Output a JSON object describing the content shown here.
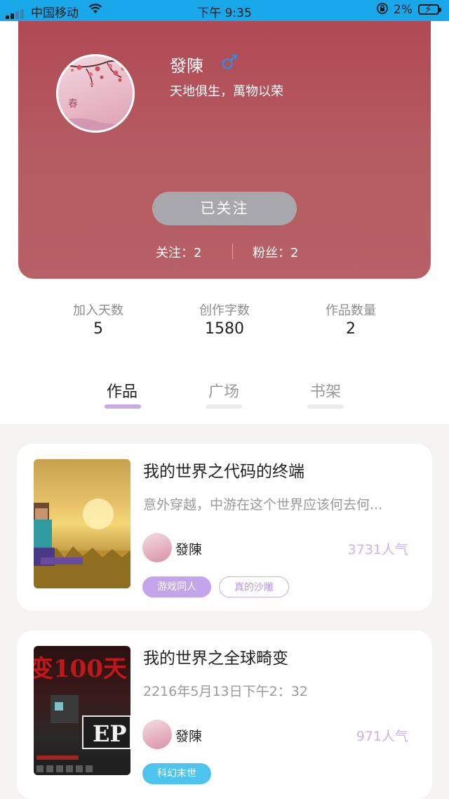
{
  "status_bar": {
    "carrier": "中国移动",
    "time": "下午 9:35",
    "battery_percent": "2%"
  },
  "profile": {
    "nickname": "發陳",
    "gender_symbol": "♂",
    "bio": "天地俱生，萬物以荣",
    "follow_button": "已关注",
    "following_text": "关注：2",
    "fans_text": "粉丝：2"
  },
  "stats": [
    {
      "label": "加入天数",
      "value": "5"
    },
    {
      "label": "创作字数",
      "value": "1580"
    },
    {
      "label": "作品数量",
      "value": "2"
    }
  ],
  "tabs": [
    {
      "label": "作品",
      "active": true
    },
    {
      "label": "广场",
      "active": false
    },
    {
      "label": "书架",
      "active": false
    }
  ],
  "works": [
    {
      "title": "我的世界之代码的终端",
      "subtitle": "意外穿越，中游在这个世界应该何去何...",
      "author": "發陳",
      "popularity": "3731人气",
      "tags": [
        "游戏同人",
        "真的沙雕"
      ]
    },
    {
      "title": "我的世界之全球畸变",
      "subtitle": "2216年5月13日下午2：32",
      "author": "發陳",
      "popularity": "971人气",
      "tags": [
        "科幻末世"
      ]
    }
  ],
  "colors": {
    "header": "#b24d56",
    "accent_purple": "#c4a4ea",
    "tag_blue": "#4cc4ee",
    "status_bar": "#18a8ea"
  }
}
